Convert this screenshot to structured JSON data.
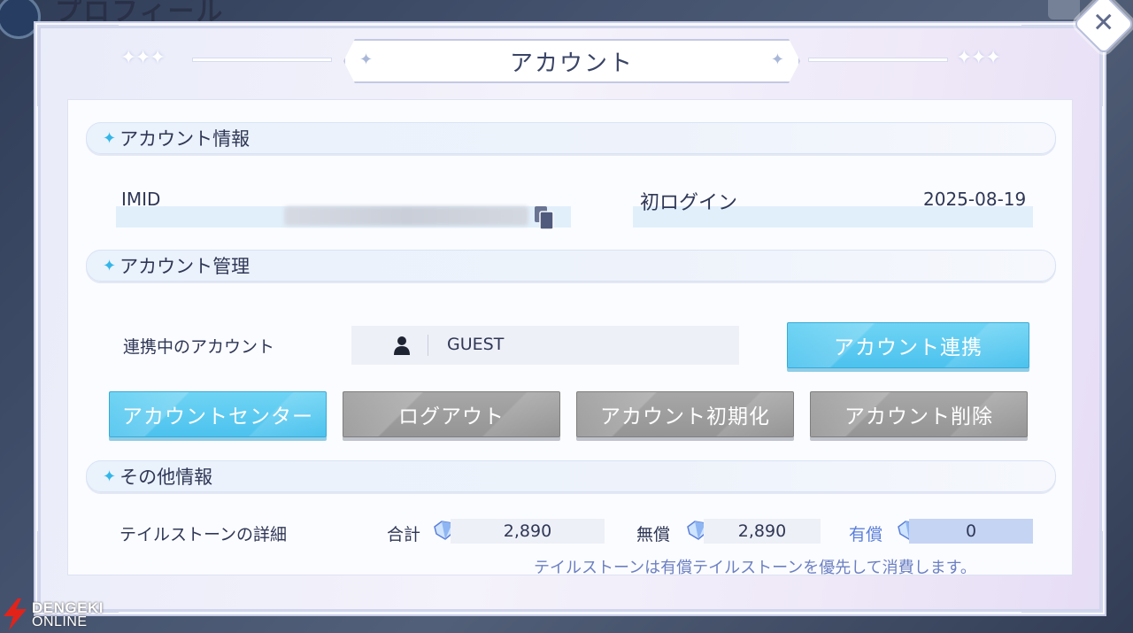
{
  "background": {
    "title": "プロフィール"
  },
  "dialog": {
    "title": "アカウント",
    "close_icon": "close-icon"
  },
  "account_info": {
    "header": "アカウント情報",
    "imid_label": "IMID",
    "first_login_label": "初ログイン",
    "first_login_value": "2025-08-19"
  },
  "account_management": {
    "header": "アカウント管理",
    "linked_label": "連携中のアカウント",
    "linked_value": "GUEST",
    "link_button": "アカウント連携",
    "buttons": {
      "center": "アカウントセンター",
      "logout": "ログアウト",
      "reset": "アカウント初期化",
      "delete": "アカウント削除"
    }
  },
  "other_info": {
    "header": "その他情報",
    "tailstone_label": "テイルストーンの詳細",
    "total_label": "合計",
    "total_value": "2,890",
    "free_label": "無償",
    "free_value": "2,890",
    "paid_label": "有償",
    "paid_value": "0",
    "note": "テイルストーンは有償テイルストーンを優先して消費します。"
  },
  "watermark": {
    "line1": "DENGEKI",
    "line2": "ONLINE"
  },
  "colors": {
    "accent_blue": "#4cc2ee",
    "button_gray": "#9a9a9a",
    "paid_label": "#5b7fd9",
    "star": "#33b6e8"
  }
}
